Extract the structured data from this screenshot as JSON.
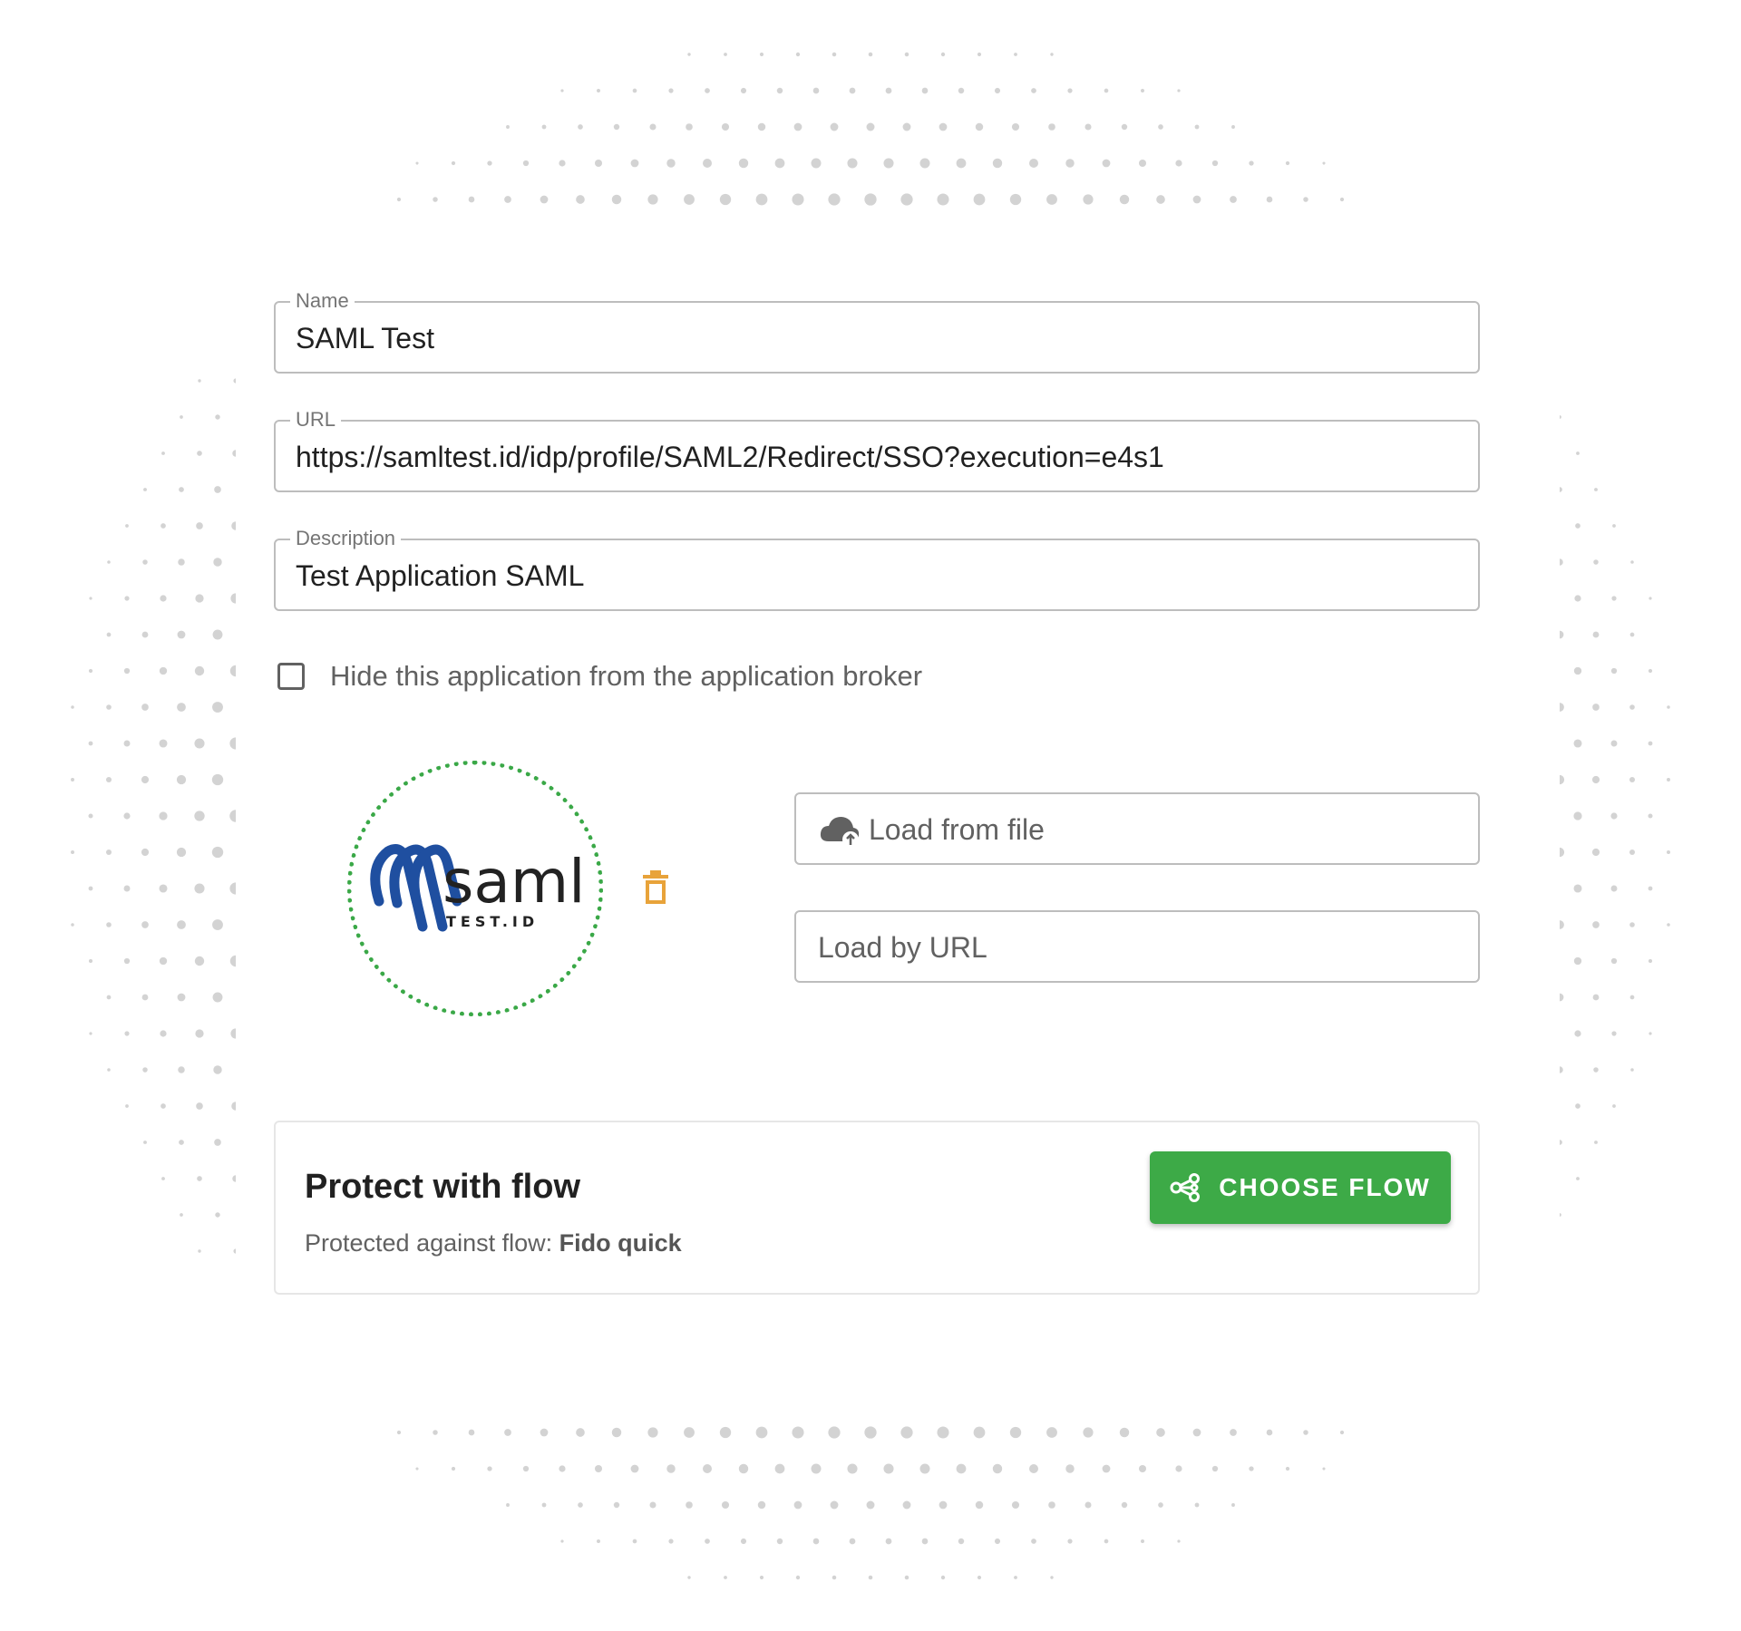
{
  "form": {
    "name": {
      "label": "Name",
      "value": "SAML Test"
    },
    "url": {
      "label": "URL",
      "value": "https://samltest.id/idp/profile/SAML2/Redirect/SSO?execution=e4s1"
    },
    "description": {
      "label": "Description",
      "value": "Test Application SAML"
    }
  },
  "hide_checkbox": {
    "label": "Hide this application from the application broker",
    "checked": false
  },
  "logo": {
    "word": "saml",
    "sub": "TEST.ID"
  },
  "icons": {
    "upload": "cloud-upload-icon",
    "delete": "trash-icon",
    "flow": "share-icon"
  },
  "load_file": {
    "label": "Load from file"
  },
  "load_url": {
    "label": "Load by URL"
  },
  "flow": {
    "title": "Protect with flow",
    "subtitle_prefix": "Protected against flow: ",
    "flow_name": "Fido quick",
    "button_label": "CHOOSE FLOW"
  },
  "colors": {
    "accent_green": "#3daa47",
    "delete_orange": "#e8a33a",
    "logo_blue": "#1f4fa0"
  }
}
